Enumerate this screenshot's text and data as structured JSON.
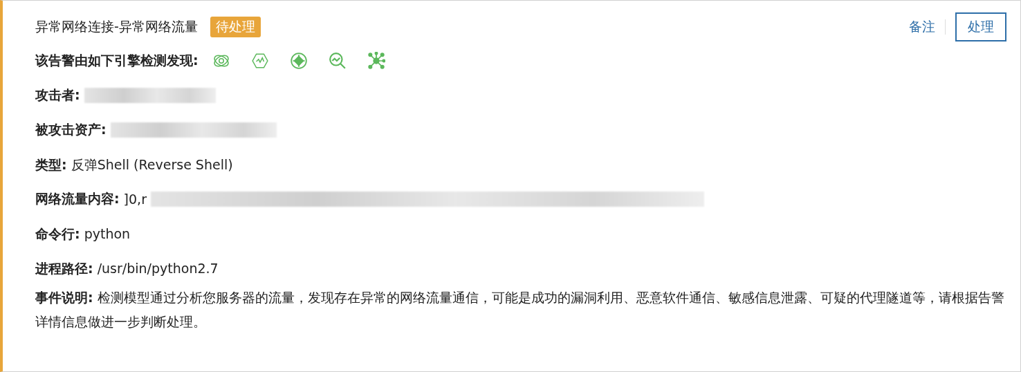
{
  "alert": {
    "title": "异常网络连接-异常网络流量",
    "status": "待处理"
  },
  "actions": [
    {
      "label": "备注",
      "kind": "link"
    },
    {
      "label": "处理",
      "kind": "outlined"
    }
  ],
  "engines_label": "该告警由如下引擎检测发现:",
  "fields": [
    {
      "label": "攻击者:",
      "kind": "redacted"
    },
    {
      "label": "被攻击资产:",
      "kind": "redacted"
    },
    {
      "label": "类型:",
      "kind": "text",
      "value": "反弹Shell (Reverse Shell)"
    },
    {
      "label": "网络流量内容:",
      "kind": "redacted",
      "prefix": "]0,r"
    },
    {
      "label": "命令行:",
      "kind": "text",
      "value": "python"
    },
    {
      "label": "进程路径:",
      "kind": "text",
      "value": "/usr/bin/python2.7"
    },
    {
      "label": "事件说明:",
      "kind": "text",
      "value": "检测模型通过分析您服务器的流量，发现存在异常的网络流量通信，可能是成功的漏洞利用、恶意软件通信、敏感信息泄露、可疑的代理隧道等，请根据告警详情信息做进一步判断处理。"
    }
  ]
}
